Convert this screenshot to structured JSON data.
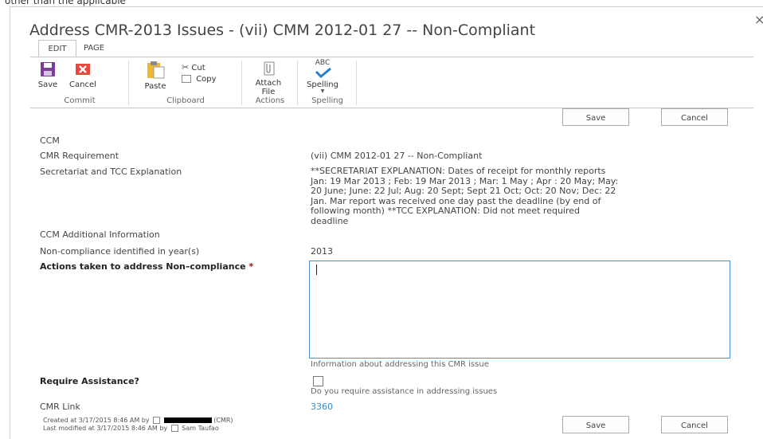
{
  "top_banner": "other than the applicable",
  "dialog": {
    "title": "Address CMR-2013 Issues - (vii) CMM 2012-01 27 -- Non-Compliant",
    "close_glyph": "×"
  },
  "ribbon": {
    "tabs": [
      {
        "label": "EDIT",
        "active": true
      },
      {
        "label": "PAGE",
        "active": false
      }
    ],
    "groups": {
      "commit": {
        "name": "Commit",
        "save": "Save",
        "cancel": "Cancel"
      },
      "clipboard": {
        "name": "Clipboard",
        "paste": "Paste",
        "cut": "Cut",
        "copy": "Copy"
      },
      "actions": {
        "name": "Actions",
        "attach_line1": "Attach",
        "attach_line2": "File"
      },
      "spelling": {
        "name": "Spelling",
        "spelling": "Spelling",
        "abc": "ABC"
      }
    },
    "icons": {
      "save": "save-icon",
      "cancel": "cancel-icon",
      "paste": "paste-icon",
      "cut": "cut-icon",
      "copy": "copy-icon",
      "attach": "attach-file-icon",
      "spelling": "spelling-icon"
    }
  },
  "form": {
    "buttons": {
      "save": "Save",
      "cancel": "Cancel"
    },
    "fields": {
      "ccm_label": "CCM",
      "cmr_req_label": "CMR Requirement",
      "cmr_req_value": "(vii) CMM 2012-01 27 -- Non-Compliant",
      "explanation_label": "Secretariat and TCC Explanation",
      "explanation_lines": [
        "**SECRETARIAT EXPLANATION: Dates of receipt for monthly reports",
        "Jan: 19 Mar 2013 ; Feb: 19 Mar 2013 ; Mar: 1 May ; Apr : 20 May; May:",
        "20 June; June: 22 Jul; Aug: 20 Sept; Sept 21 Oct; Oct: 20 Nov; Dec: 22",
        "Jan. Mar report was received one day past the deadline (by end of",
        "following month) **TCC EXPLANATION: Did not meet required",
        "deadline"
      ],
      "additional_info_label": "CCM Additional Information",
      "year_label": "Non-compliance identified in year(s)",
      "year_value": "2013",
      "actions_label": "Actions taken to address Non–compliance",
      "required_marker": "*",
      "actions_value": "",
      "actions_hint": "Information about addressing this CMR issue",
      "assist_label": "Require Assistance?",
      "assist_checked": false,
      "assist_hint": "Do you require assistance in addressing issues",
      "link_label": "CMR Link",
      "link_value": "3360"
    },
    "footer": {
      "created_prefix": "Created at 3/17/2015 8:46 AM by",
      "created_suffix": "(CMR)",
      "modified_prefix": "Last modified at 3/17/2015 8:46 AM by",
      "modified_user": "Sam Taufao"
    },
    "colors": {
      "accent": "#2a8dd4",
      "save_icon": "#7d3c98",
      "cancel_icon": "#e8473b",
      "required": "#bf0000"
    }
  }
}
